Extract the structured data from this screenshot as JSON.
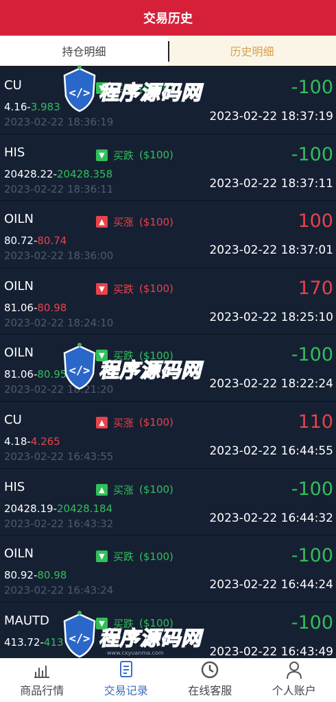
{
  "header": {
    "title": "交易历史"
  },
  "tabs": [
    {
      "label": "持仓明细",
      "active": false
    },
    {
      "label": "历史明细",
      "active": true
    }
  ],
  "orders": [
    {
      "symbol": "CU",
      "open_price": "4.16",
      "close_price": "3.983",
      "close_color": "green",
      "direction": "买涨",
      "arrow": "down",
      "dir_color": "green",
      "stake": "($100)",
      "amount": "-100",
      "amount_color": "green",
      "open_time": "2023-02-22 18:36:19",
      "close_time": "2023-02-22 18:37:19"
    },
    {
      "symbol": "HIS",
      "open_price": "20428.22",
      "close_price": "20428.358",
      "close_color": "green",
      "direction": "买跌",
      "arrow": "down",
      "dir_color": "green",
      "stake": "($100)",
      "amount": "-100",
      "amount_color": "green",
      "open_time": "2023-02-22 18:36:11",
      "close_time": "2023-02-22 18:37:11"
    },
    {
      "symbol": "OILN",
      "open_price": "80.72",
      "close_price": "80.74",
      "close_color": "red",
      "direction": "买涨",
      "arrow": "up",
      "dir_color": "red",
      "stake": "($100)",
      "amount": "100",
      "amount_color": "red",
      "open_time": "2023-02-22 18:36:00",
      "close_time": "2023-02-22 18:37:01"
    },
    {
      "symbol": "OILN",
      "open_price": "81.06",
      "close_price": "80.98",
      "close_color": "red",
      "direction": "买跌",
      "arrow": "down",
      "dir_color": "red",
      "stake": "($100)",
      "amount": "170",
      "amount_color": "red",
      "open_time": "2023-02-22 18:24:10",
      "close_time": "2023-02-22 18:25:10"
    },
    {
      "symbol": "OILN",
      "open_price": "81.06",
      "close_price": "80.95",
      "close_color": "green",
      "direction": "买跌",
      "arrow": "down",
      "dir_color": "green",
      "stake": "($100)",
      "amount": "-100",
      "amount_color": "green",
      "open_time": "2023-02-22 18:21:20",
      "close_time": "2023-02-22 18:22:24"
    },
    {
      "symbol": "CU",
      "open_price": "4.18",
      "close_price": "4.265",
      "close_color": "red",
      "direction": "买涨",
      "arrow": "up",
      "dir_color": "red",
      "stake": "($100)",
      "amount": "110",
      "amount_color": "red",
      "open_time": "2023-02-22 16:43:55",
      "close_time": "2023-02-22 16:44:55"
    },
    {
      "symbol": "HIS",
      "open_price": "20428.19",
      "close_price": "20428.184",
      "close_color": "green",
      "direction": "买涨",
      "arrow": "up",
      "dir_color": "green",
      "stake": "($100)",
      "amount": "-100",
      "amount_color": "green",
      "open_time": "2023-02-22 16:43:32",
      "close_time": "2023-02-22 16:44:32"
    },
    {
      "symbol": "OILN",
      "open_price": "80.92",
      "close_price": "80.98",
      "close_color": "green",
      "direction": "买跌",
      "arrow": "down",
      "dir_color": "green",
      "stake": "($100)",
      "amount": "-100",
      "amount_color": "green",
      "open_time": "2023-02-22 16:43:24",
      "close_time": "2023-02-22 16:44:24"
    },
    {
      "symbol": "MAUTD",
      "open_price": "413.72",
      "close_price": "413",
      "close_color": "green",
      "direction": "买跌",
      "arrow": "down",
      "dir_color": "green",
      "stake": "($100)",
      "amount": "-100",
      "amount_color": "green",
      "open_time": "",
      "close_time": "2023-02-22 16:43:49"
    }
  ],
  "watermark": {
    "text": "程序源码网",
    "url": "www.cxyuanma.com"
  },
  "bottom_nav": [
    {
      "label": "商品行情",
      "icon": "chart-icon",
      "active": false
    },
    {
      "label": "交易记录",
      "icon": "document-icon",
      "active": true
    },
    {
      "label": "在线客服",
      "icon": "clock-icon",
      "active": false
    },
    {
      "label": "个人账户",
      "icon": "user-icon",
      "active": false
    }
  ],
  "colors": {
    "header": "#d6203a",
    "up_green": "#31bf5a",
    "down_red": "#e8424a",
    "active_tab": "#d2a24a",
    "active_nav": "#3a6fc4"
  }
}
